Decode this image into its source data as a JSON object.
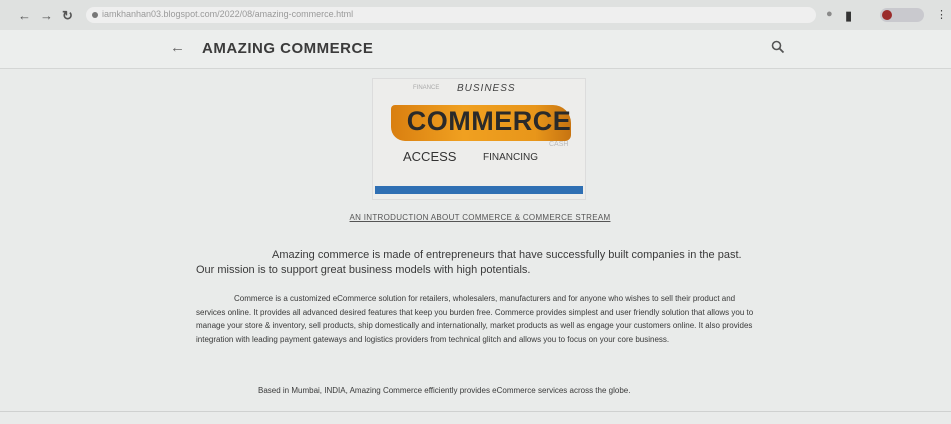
{
  "browser": {
    "url": "iamkhanhan03.blogspot.com/2022/08/amazing-commerce.html",
    "icons": [
      "back-arrow-icon",
      "forward-arrow-icon",
      "reload-icon",
      "lock-icon",
      "extension-icon",
      "profile-icon",
      "menu-icon"
    ]
  },
  "header": {
    "back_icon": "←",
    "title": "AMAZING COMMERCE",
    "search_icon": "search-icon"
  },
  "hero": {
    "finance": "FINANCE",
    "business": "BUSINESS",
    "commerce": "COMMERCE",
    "access": "ACCESS",
    "financing": "FINANCING",
    "cash": "CASH",
    "accent_color": "#e8961a",
    "bar_color": "#2f6fb3"
  },
  "article": {
    "caption": "AN INTRODUCTION ABOUT COMMERCE & COMMERCE STREAM",
    "intro": "Amazing commerce is made of entrepreneurs that have successfully built companies in the past. Our mission is to support great business models with high potentials.",
    "description": "Commerce is a customized eCommerce solution for retailers, wholesalers, manufacturers and for anyone who wishes to sell their product and services online. It provides all advanced desired features that keep you burden free. Commerce provides simplest and user friendly solution that allows you to manage your store & inventory, sell products, ship domestically and internationally, market products as well as engage your customers online. It also provides integration with leading payment gateways and logistics providers from technical glitch and allows you to focus on your core business.",
    "footer": "Based in Mumbai, INDIA, Amazing Commerce efficiently provides eCommerce services across the globe."
  }
}
